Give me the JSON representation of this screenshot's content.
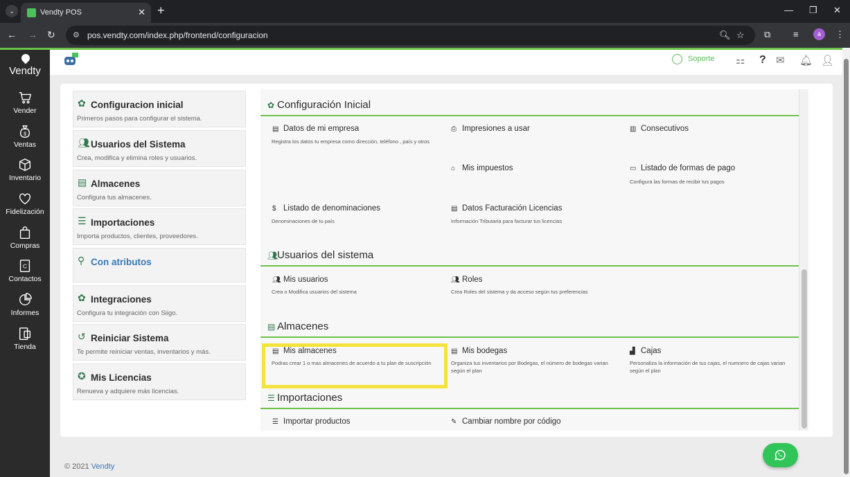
{
  "browser": {
    "tab_title": "Vendty POS",
    "tab_close": "✕",
    "new_tab": "+",
    "url": "pos.vendty.com/index.php/frontend/configuracion"
  },
  "sidebar": {
    "logo": "Vendty",
    "items": [
      {
        "label": "Vender",
        "icon": "cart-icon"
      },
      {
        "label": "Ventas",
        "icon": "money-bag-icon"
      },
      {
        "label": "Inventario",
        "icon": "box-icon"
      },
      {
        "label": "Fidelización",
        "icon": "heart-icon"
      },
      {
        "label": "Compras",
        "icon": "shopping-bag-icon"
      },
      {
        "label": "Contactos",
        "icon": "contacts-icon"
      },
      {
        "label": "Informes",
        "icon": "pie-chart-icon"
      },
      {
        "label": "Tienda",
        "icon": "store-icon"
      }
    ]
  },
  "header": {
    "support_label": "Soporte"
  },
  "left_menu": [
    {
      "title": "Configuracion inicial",
      "desc": "Primeros pasos para configurar el sistema."
    },
    {
      "title": "Usuarios del Sistema",
      "desc": "Crea, modifica y elimina roles y usuarios."
    },
    {
      "title": "Almacenes",
      "desc": "Configura tus almacenes."
    },
    {
      "title": "Importaciones",
      "desc": "Importa productos, clientes, proveedores."
    },
    {
      "title": "Con atributos",
      "desc": ""
    },
    {
      "title": "Integraciones",
      "desc": "Configura tu integración con Siigo."
    },
    {
      "title": "Reiniciar Sistema",
      "desc": "Te permite reiniciar ventas, inventarios y más."
    },
    {
      "title": "Mis Licencias",
      "desc": "Renueva y adquiere más licencias."
    }
  ],
  "sections": {
    "config": {
      "title": "Configuración Inicial",
      "datos_empresa": {
        "title": "Datos de mi empresa",
        "desc": "Registra los datos tu empresa como dirección, teléfono , país y otros"
      },
      "impresiones": {
        "title": "Impresiones a usar"
      },
      "consecutivos": {
        "title": "Consecutivos"
      },
      "impuestos": {
        "title": "Mis impuestos"
      },
      "formas_pago": {
        "title": "Listado de formas de pago",
        "desc": "Configura las formas de recibir tus pagos"
      },
      "denominaciones": {
        "title": "Listado de denominaciones",
        "desc": "Denominaciones de tu país"
      },
      "facturacion": {
        "title": "Datos Facturación Licencias",
        "desc": "Información Tributaria para facturar tus licencias"
      }
    },
    "usuarios": {
      "title": "Usuarios del sistema",
      "mis_usuarios": {
        "title": "Mis usuarios",
        "desc": "Crea o Modifica usuarios del sistema"
      },
      "roles": {
        "title": "Roles",
        "desc": "Crea Roles del sistema y da acceso según tus preferencias"
      }
    },
    "almacenes": {
      "title": "Almacenes",
      "mis_almacenes": {
        "title": "Mis almacenes",
        "desc": "Podras crear 1 o mas almacenes de acuerdo a tu plan de suscripción"
      },
      "bodegas": {
        "title": "Mis bodegas",
        "desc": "Organiza tus inventarios por Bodegas, el número de bodegas varian según el plan"
      },
      "cajas": {
        "title": "Cajas",
        "desc": "Personaliza la información de tus cajas, el numnero de cajas varian según el plan"
      }
    },
    "importaciones": {
      "title": "Importaciones",
      "importar_productos": {
        "title": "Importar productos"
      },
      "cambiar_nombre": {
        "title": "Cambiar nombre por código"
      }
    }
  },
  "footer": {
    "copyright": "© 2021",
    "brand": "Vendty"
  },
  "colors": {
    "accent_green": "#6cc24a",
    "sidebar_bg": "#2b2b2b",
    "highlight": "#f5e33b",
    "whatsapp": "#31c458"
  }
}
